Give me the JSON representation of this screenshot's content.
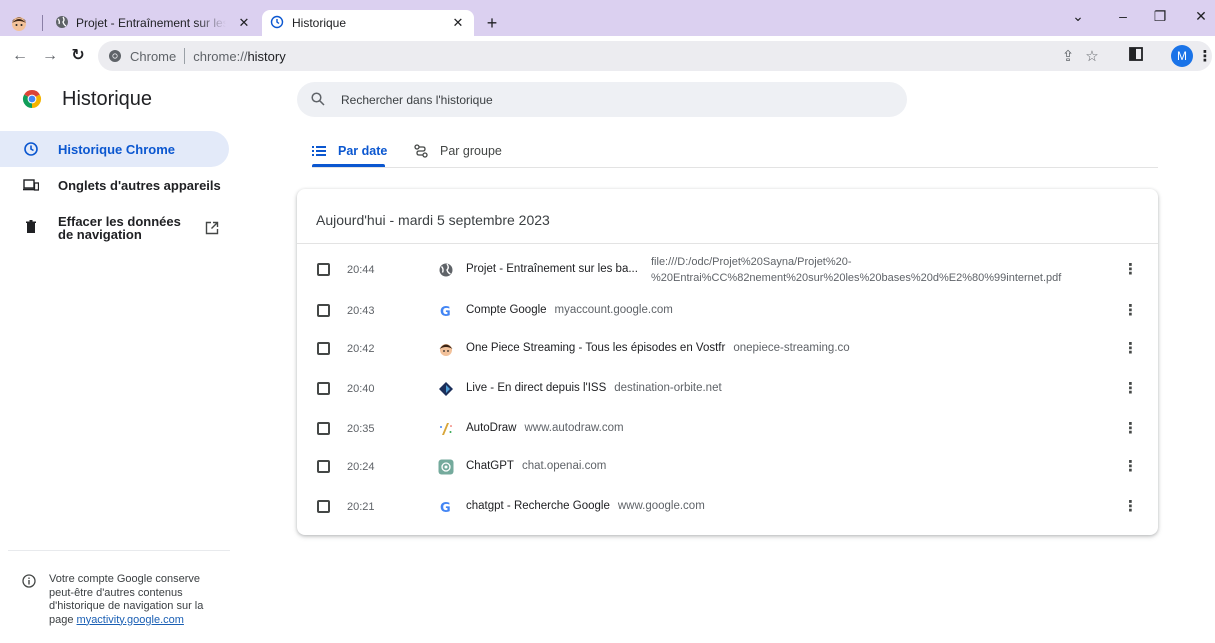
{
  "window": {
    "tabs": [
      {
        "title": "Projet - Entraînement sur les bas",
        "active": false
      },
      {
        "title": "Historique",
        "active": true
      }
    ],
    "new_tab_symbol": "+",
    "controls": {
      "dropdown": "⌄",
      "minimize": "–",
      "restore": "❐",
      "close": "✕"
    }
  },
  "toolbar": {
    "omnibox_chip": "Chrome",
    "url_scheme": "chrome://",
    "url_host": "history",
    "profile_initial": "M"
  },
  "header": {
    "title": "Historique",
    "search_placeholder": "Rechercher dans l'historique"
  },
  "sidebar": {
    "items": [
      {
        "label": "Historique Chrome",
        "icon": "history-icon",
        "active": true
      },
      {
        "label": "Onglets d'autres appareils",
        "icon": "devices-icon",
        "active": false
      },
      {
        "label": "Effacer les données de navigation",
        "icon": "trash-icon",
        "active": false
      }
    ],
    "note_text": "Votre compte Google conserve peut-être d'autres contenus d'historique de navigation sur la page ",
    "note_link": "myactivity.google.com"
  },
  "main": {
    "tabs": [
      {
        "label": "Par date",
        "active": true
      },
      {
        "label": "Par groupe",
        "active": false
      }
    ],
    "day_header": "Aujourd'hui - mardi 5 septembre 2023",
    "entries": [
      {
        "time": "20:44",
        "title": "Projet - Entraînement sur les ba...",
        "domain": "",
        "url_line1": "file:///D:/odc/Projet%20Sayna/Projet%20-",
        "url_line2": "%20Entrai%CC%82nement%20sur%20les%20bases%20d%E2%80%99internet.pdf",
        "favicon": "globe-icon"
      },
      {
        "time": "20:43",
        "title": "Compte Google",
        "domain": "myaccount.google.com",
        "favicon": "google-icon"
      },
      {
        "time": "20:42",
        "title": "One Piece Streaming - Tous les épisodes en Vostfr",
        "domain": "onepiece-streaming.co",
        "favicon": "onepiece-icon"
      },
      {
        "time": "20:40",
        "title": "Live - En direct depuis l'ISS",
        "domain": "destination-orbite.net",
        "favicon": "orbite-icon"
      },
      {
        "time": "20:35",
        "title": "AutoDraw",
        "domain": "www.autodraw.com",
        "favicon": "autodraw-icon"
      },
      {
        "time": "20:24",
        "title": "ChatGPT",
        "domain": "chat.openai.com",
        "favicon": "chatgpt-icon"
      },
      {
        "time": "20:21",
        "title": "chatgpt - Recherche Google",
        "domain": "www.google.com",
        "favicon": "google-icon"
      }
    ]
  },
  "colors": {
    "tabstrip": "#dbd0f0",
    "accent": "#0b57d0",
    "active_side_bg": "#e3eaf9"
  }
}
